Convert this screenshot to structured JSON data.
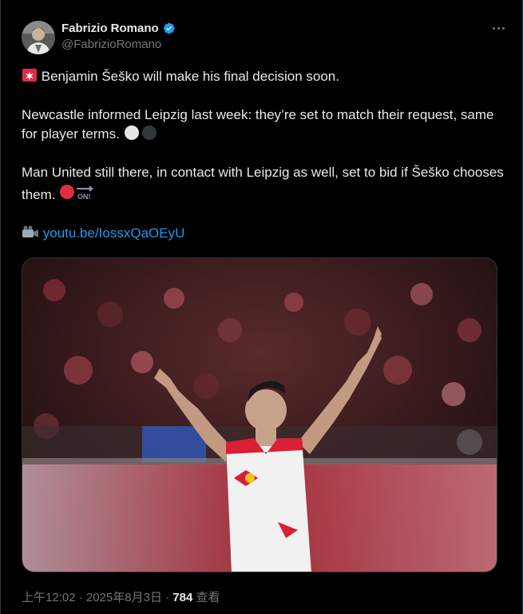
{
  "author": {
    "display_name": "Fabrizio Romano",
    "handle": "@FabrizioRomano",
    "verified": true,
    "avatar_icon": "profile-photo",
    "verified_icon": "verified-badge-icon"
  },
  "menu": {
    "more_icon": "more-options-icon"
  },
  "tweet": {
    "line1": "Benjamin Šeško will make his final decision soon.",
    "line1_emoji": "siren-icon",
    "line2": "Newcastle informed Leipzig last week: they’re set to match their request, same for player terms.",
    "line2_emoji": "white-and-black-circles",
    "line3": "Man United still there, in contact with Leipzig as well, set to bid if Šeško chooses them.",
    "line3_emoji": "red-circle-and-on-arrow",
    "on_badge": "ON!",
    "link_icon": "camera-icon",
    "link_text": "youtu.be/IossxQaOEyU"
  },
  "media": {
    "description_icon": "player-celebration-photo"
  },
  "meta": {
    "time": "上午12:02",
    "separator": " · ",
    "date": "2025年8月3日",
    "views": "784",
    "views_label": "查看"
  },
  "colors": {
    "background": "#000000",
    "text": "#e7e9ea",
    "muted": "#71767b",
    "link": "#1d9bf0",
    "verified": "#1d9bf0"
  }
}
